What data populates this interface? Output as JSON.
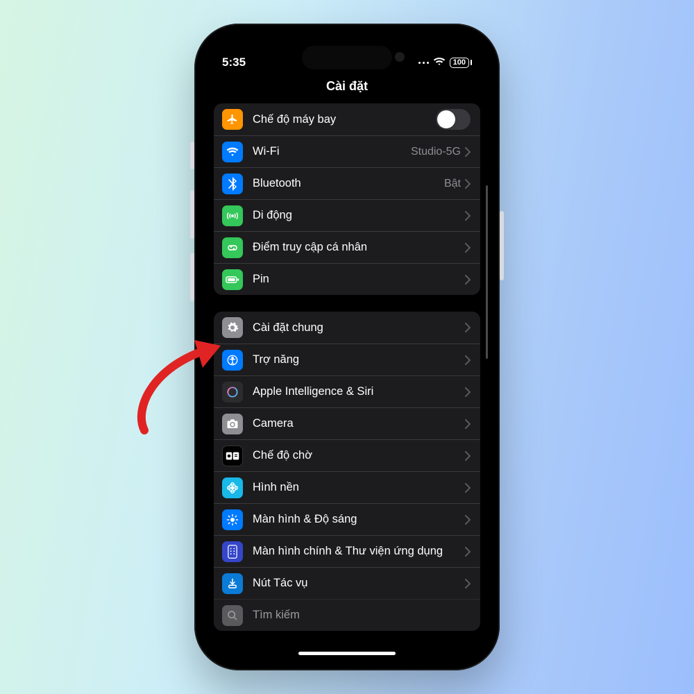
{
  "status": {
    "time": "5:35",
    "battery_text": "100"
  },
  "header": {
    "title": "Cài đặt"
  },
  "group1": [
    {
      "label": "Chế độ máy bay",
      "detail": "",
      "icon": "airplane",
      "bg": "#ff9500",
      "control": "toggle",
      "state": false
    },
    {
      "label": "Wi-Fi",
      "detail": "Studio-5G",
      "icon": "wifi",
      "bg": "#007aff"
    },
    {
      "label": "Bluetooth",
      "detail": "Bật",
      "icon": "bluetooth",
      "bg": "#007aff"
    },
    {
      "label": "Di động",
      "detail": "",
      "icon": "antenna",
      "bg": "#34c759"
    },
    {
      "label": "Điểm truy cập cá nhân",
      "detail": "",
      "icon": "link",
      "bg": "#34c759"
    },
    {
      "label": "Pin",
      "detail": "",
      "icon": "battery",
      "bg": "#34c759"
    }
  ],
  "group2": [
    {
      "label": "Cài đặt chung",
      "icon": "gear",
      "bg": "#8e8e93"
    },
    {
      "label": "Trợ năng",
      "icon": "accessibility",
      "bg": "#007aff"
    },
    {
      "label": "Apple Intelligence & Siri",
      "icon": "siri",
      "bg": "#2c2c2e"
    },
    {
      "label": "Camera",
      "icon": "camera",
      "bg": "#8e8e93"
    },
    {
      "label": "Chế độ chờ",
      "icon": "standby",
      "bg": "#000000"
    },
    {
      "label": "Hình nền",
      "icon": "wallpaper",
      "bg": "#18b8e8"
    },
    {
      "label": "Màn hình & Độ sáng",
      "icon": "brightness",
      "bg": "#007aff"
    },
    {
      "label": "Màn hình chính & Thư viện ứng dụng",
      "icon": "homescreen",
      "bg": "#3546c9"
    },
    {
      "label": "Nút Tác vụ",
      "icon": "action",
      "bg": "#0a7bd6"
    },
    {
      "label": "Tìm kiếm",
      "icon": "search",
      "bg": "#8e8e93"
    }
  ],
  "annotation": {
    "type": "arrow",
    "points_to": "Cài đặt chung",
    "color": "#e02424"
  }
}
